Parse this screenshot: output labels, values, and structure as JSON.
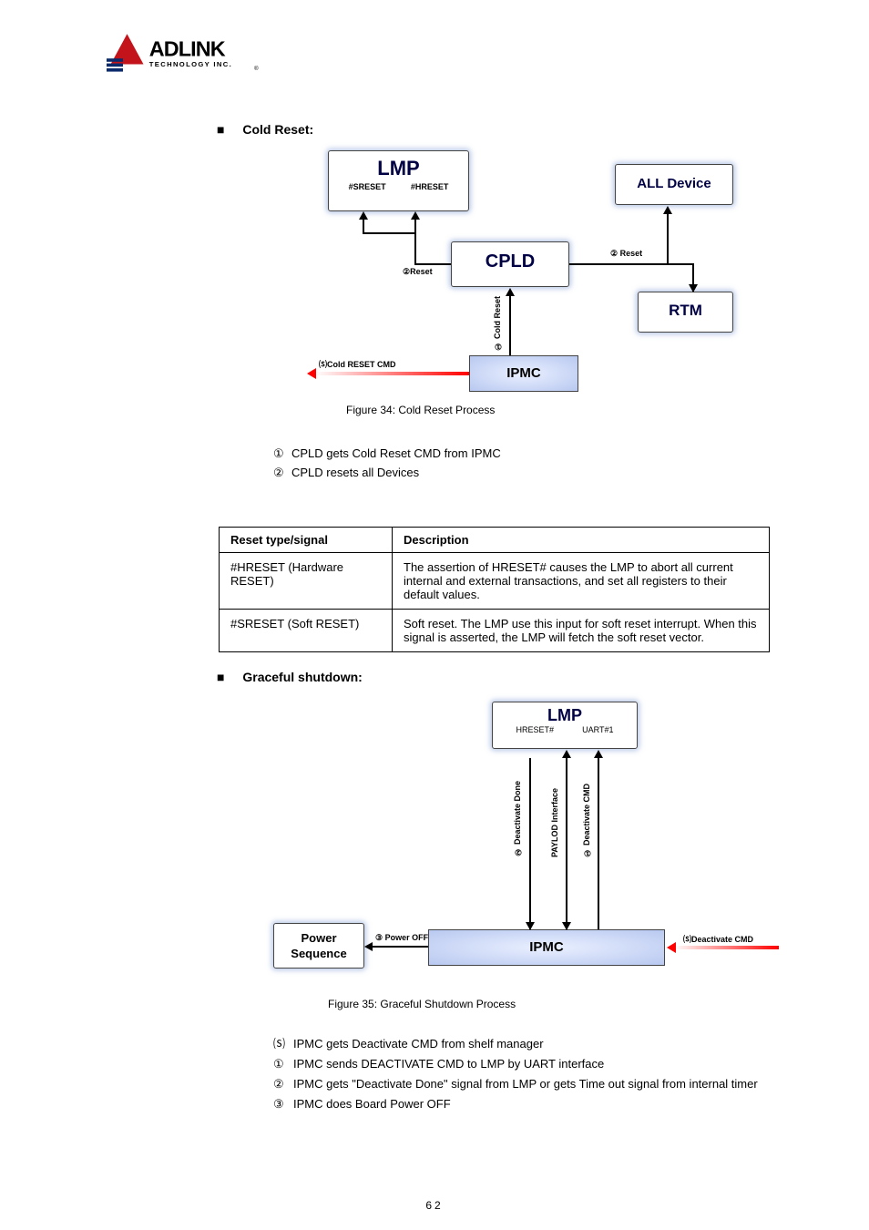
{
  "logo": {
    "brand": "ADLINK",
    "tagline": "TECHNOLOGY INC."
  },
  "section1": {
    "heading": "Cold Reset:",
    "figure_caption": "Figure 34: Cold Reset Process",
    "seq": [
      {
        "marker": "①",
        "text": "CPLD gets Cold Reset CMD from IPMC"
      },
      {
        "marker": "②",
        "text": "CPLD resets all Devices"
      }
    ],
    "table": {
      "header": {
        "c1": "Reset type/signal",
        "c2": "Description"
      },
      "rows": [
        {
          "c1": "#HRESET (Hardware RESET)",
          "c2": "The assertion of HRESET# causes the LMP to abort all current internal and external transactions, and set all registers to their default values."
        },
        {
          "c1": "#SRESET (Soft RESET)",
          "c2": "Soft reset. The LMP use this input for soft reset interrupt. When this signal is asserted, the LMP will fetch the soft reset vector."
        }
      ]
    }
  },
  "diag1": {
    "lmp_title": "LMP",
    "lmp_pin1": "#SRESET",
    "lmp_pin2": "#HRESET",
    "all": "ALL Device",
    "cpld": "CPLD",
    "rtm": "RTM",
    "ipmc": "IPMC",
    "e_reset_left": "②Reset",
    "e_reset_right": "② Reset",
    "e_coldreset": "① Cold Reset",
    "e_cmd": "⒮Cold RESET CMD"
  },
  "section2": {
    "heading": "Graceful shutdown:",
    "figure_caption": "Figure 35: Graceful Shutdown Process",
    "seq": [
      {
        "marker": "⒮",
        "text": "IPMC gets Deactivate CMD from shelf manager"
      },
      {
        "marker": "①",
        "text": "IPMC sends DEACTIVATE CMD to LMP by UART interface"
      },
      {
        "marker": "②",
        "text": "IPMC gets \"Deactivate Done\" signal from LMP or gets Time out signal from internal timer"
      },
      {
        "marker": "③",
        "text": "IPMC does Board Power OFF"
      }
    ]
  },
  "diag2": {
    "lmp_title": "LMP",
    "lmp_pin1": "HRESET#",
    "lmp_pin2": "UART#1",
    "ipmc": "IPMC",
    "power": "Power Sequence",
    "e_deact_done": "② Deactivate Done",
    "e_payload": "PAYLOD Interface",
    "e_deact_cmd": "① Deactivate CMD",
    "e_poweroff": "③ Power OFF",
    "e_scmd": "⒮Deactivate CMD"
  },
  "page_number": "62"
}
